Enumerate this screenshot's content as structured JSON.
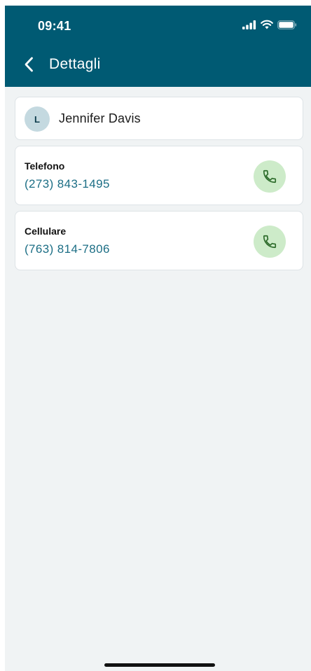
{
  "status_bar": {
    "time": "09:41",
    "icons": [
      "signal-icon",
      "wifi-icon",
      "battery-icon"
    ]
  },
  "header": {
    "title": "Dettagli",
    "back_icon": "chevron-left-icon",
    "background": "#005a73"
  },
  "contact": {
    "avatar_initial": "L",
    "name": "Jennifer Davis"
  },
  "phones": [
    {
      "label": "Telefono",
      "number": "(273) 843-1495",
      "action_icon": "phone-icon"
    },
    {
      "label": "Cellulare",
      "number": "(763) 814-7806",
      "action_icon": "phone-icon"
    }
  ],
  "colors": {
    "accent": "#005a73",
    "number_text": "#1c6e85",
    "call_button_bg": "#cdebc9",
    "call_icon": "#2c6b2a"
  }
}
